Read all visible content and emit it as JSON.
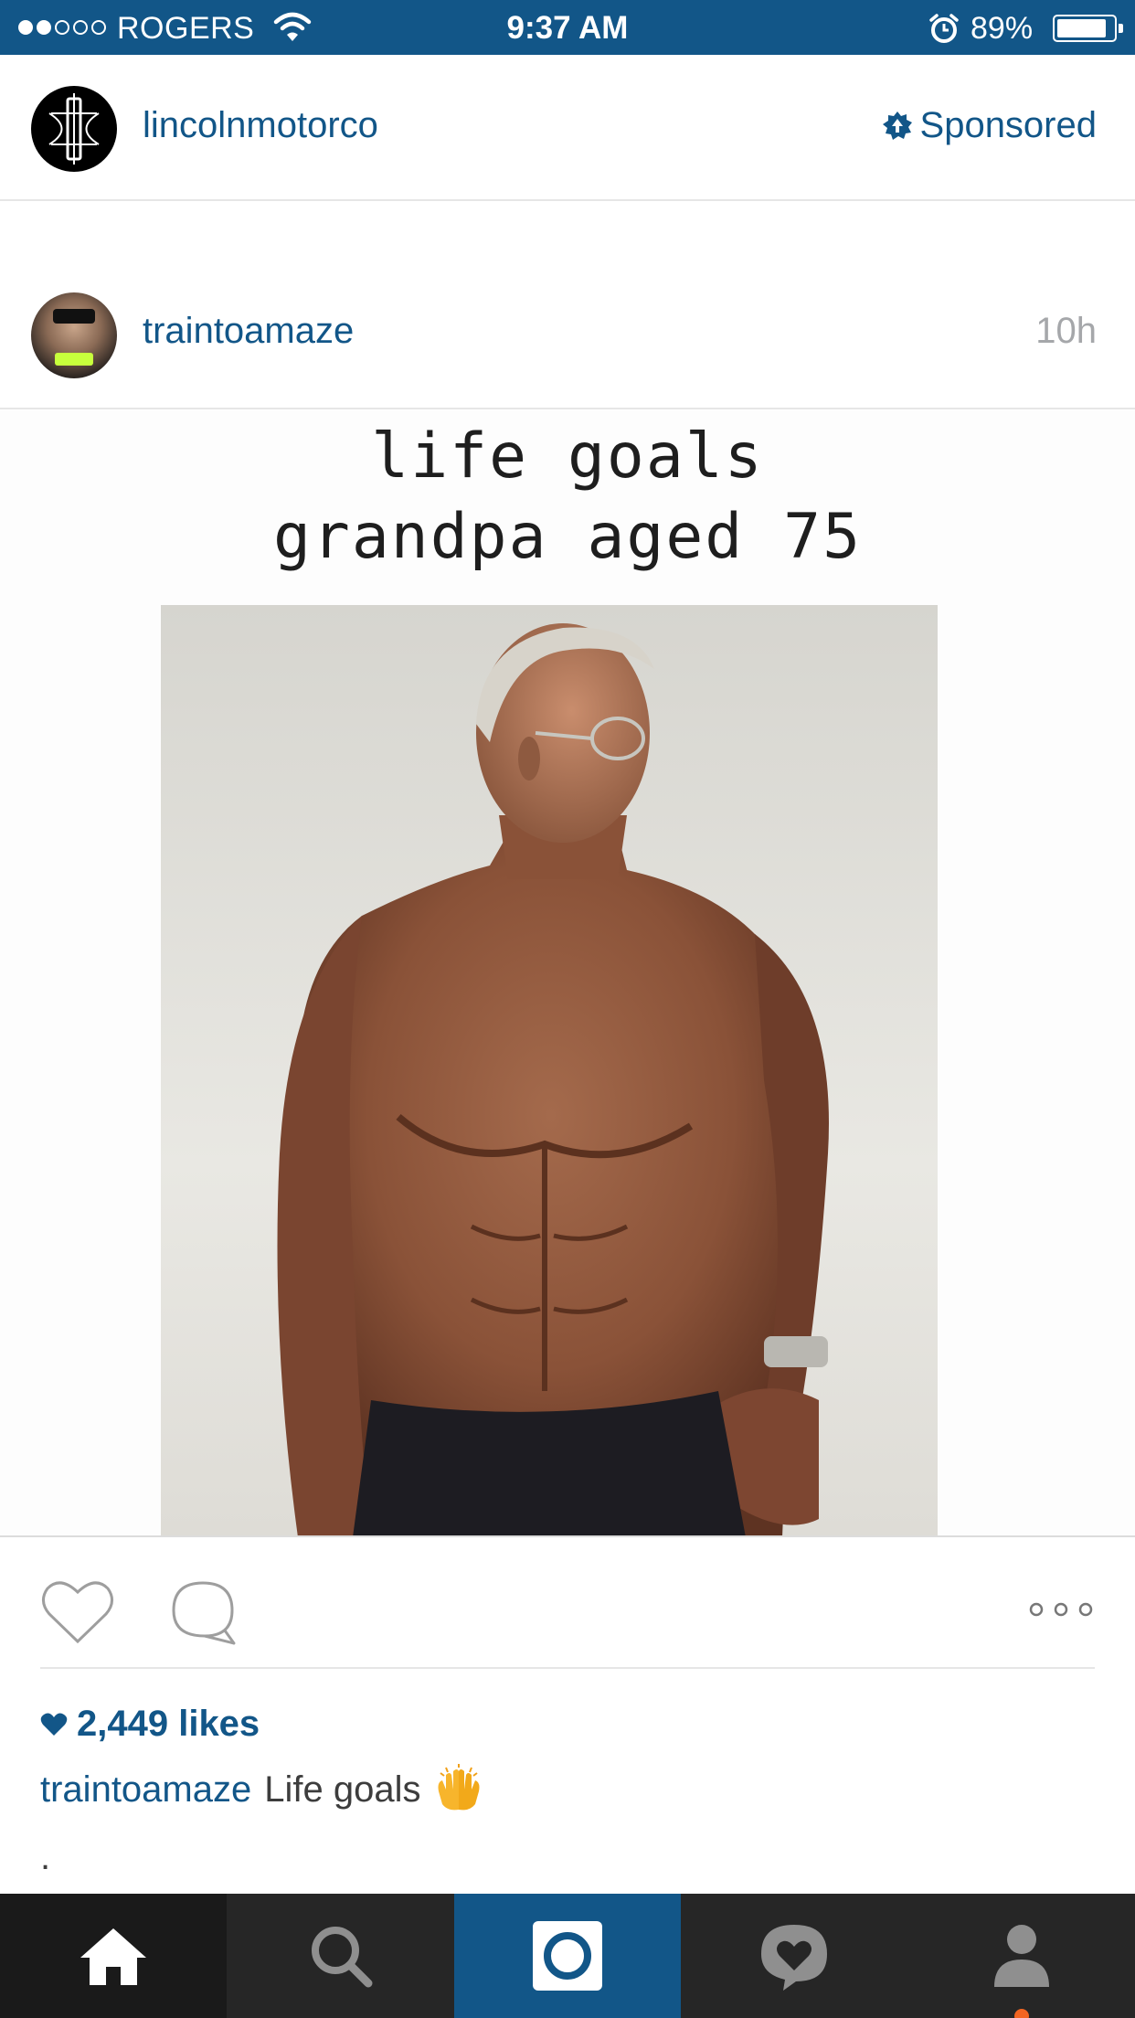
{
  "status_bar": {
    "carrier": "ROGERS",
    "time": "9:37 AM",
    "battery_percent": "89%",
    "battery_level": 0.89,
    "signal_bars_filled": 2,
    "signal_bars_total": 5
  },
  "sponsored_post": {
    "username": "lincolnmotorco",
    "label": "Sponsored"
  },
  "post": {
    "username": "traintoamaze",
    "time_ago": "10h",
    "image_text_line1": "life goals",
    "image_text_line2": "grandpa aged 75",
    "likes": "2,449 likes",
    "caption_user": "traintoamaze",
    "caption_text": "Life goals",
    "caption_emoji": "raising-hands-emoji",
    "trailing_text": "."
  },
  "tab_bar": {
    "tabs": [
      "home-icon",
      "search-icon",
      "camera-icon",
      "activity-icon",
      "profile-icon"
    ],
    "active": "home-icon"
  },
  "colors": {
    "accent": "#125688",
    "tab_bar": "#262626",
    "notification": "#f26522"
  }
}
